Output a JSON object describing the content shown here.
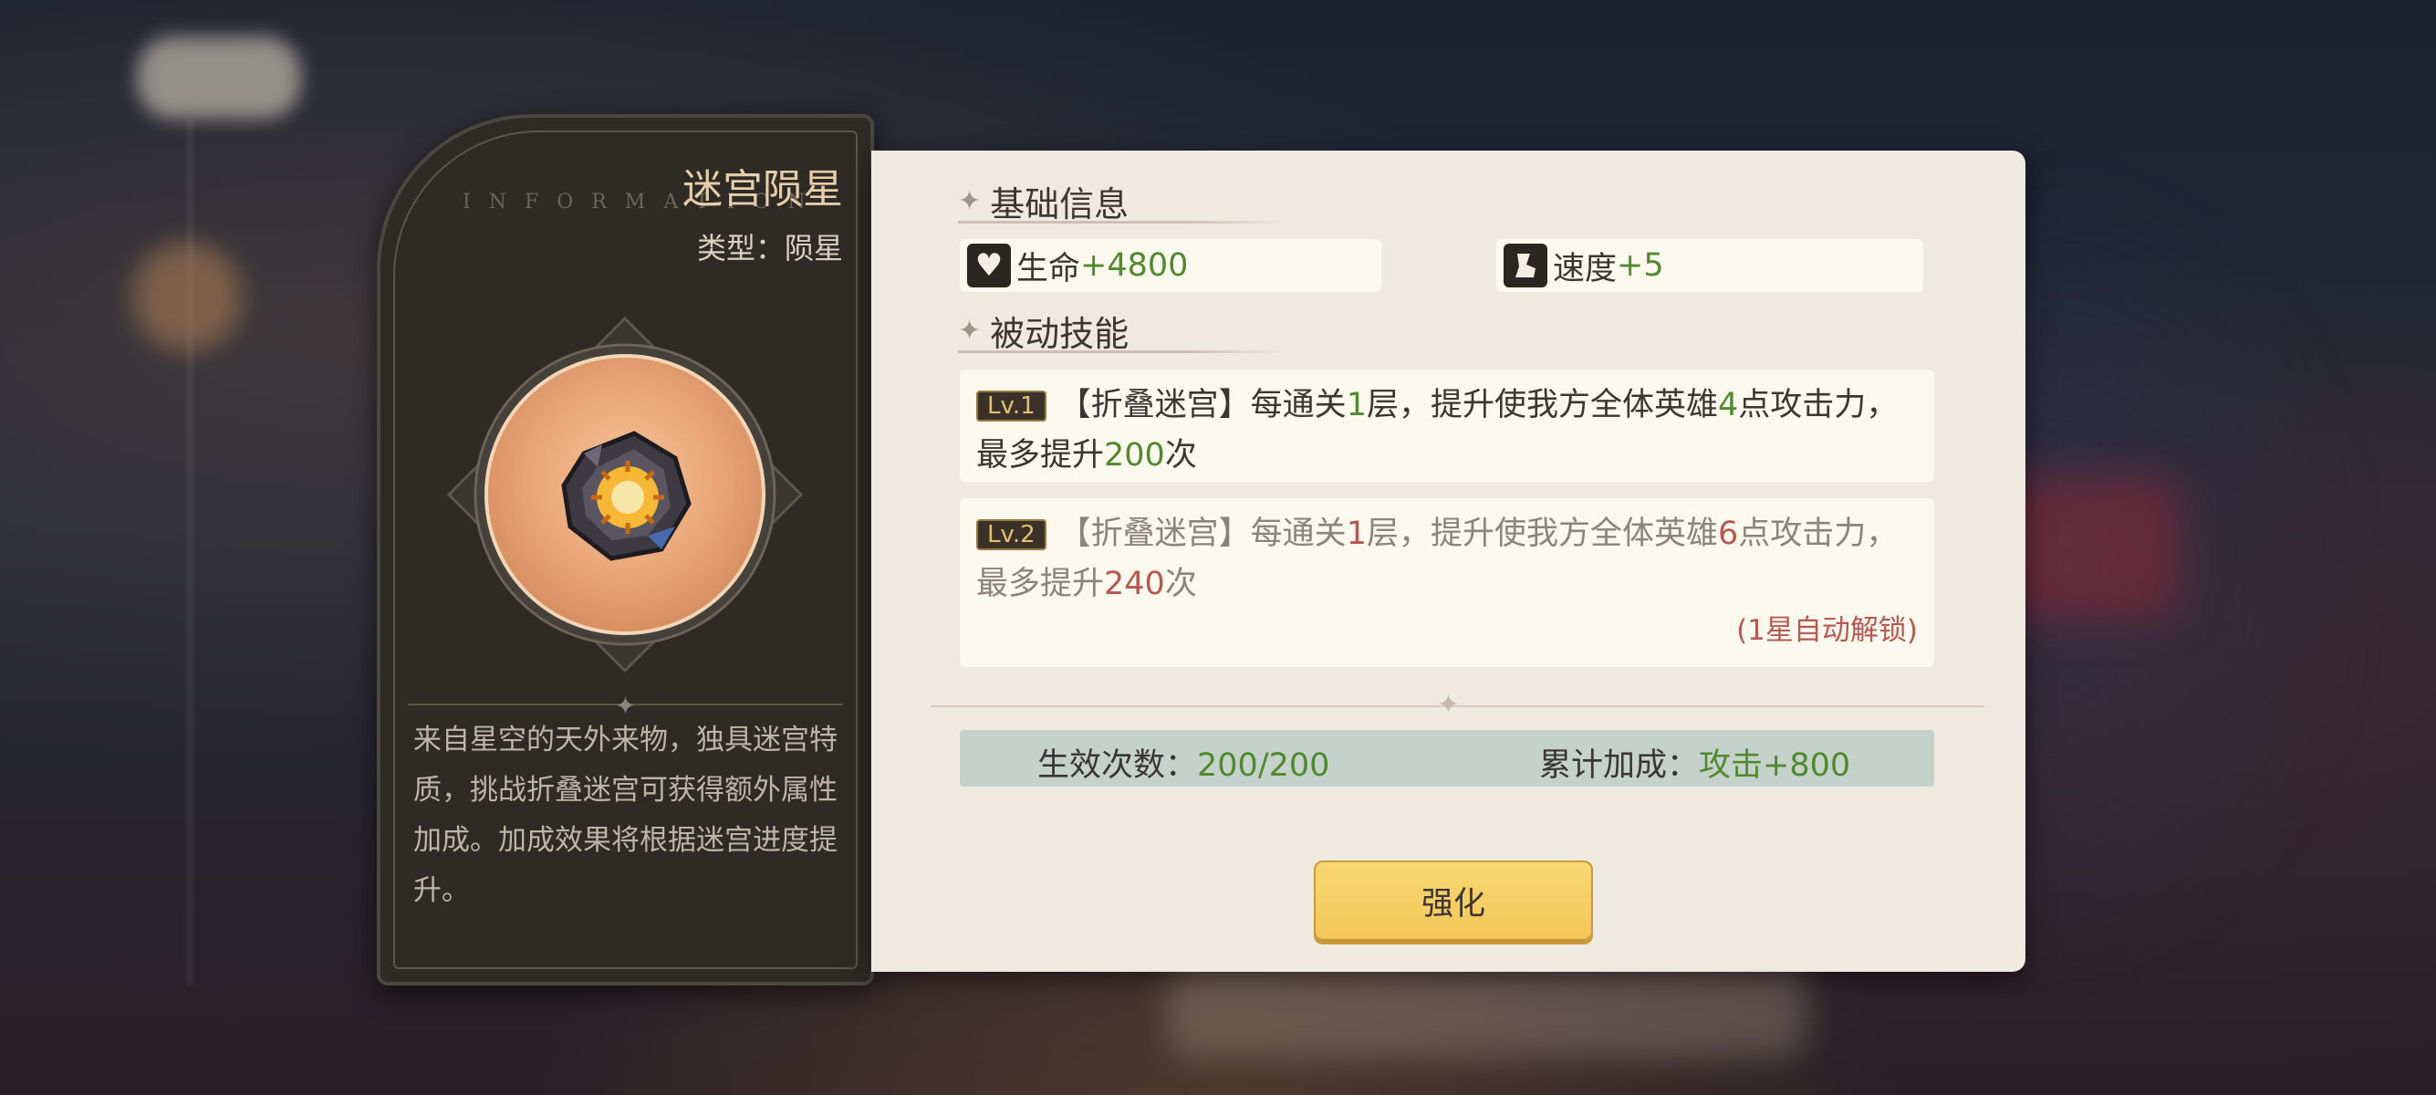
{
  "item": {
    "title": "迷宫陨星",
    "watermark": "INFORMATION",
    "type_label": "类型：",
    "type_value": "陨星",
    "description": "来自星空的天外来物，独具迷宫特质，挑战折叠迷宫可获得额外属性加成。加成效果将根据迷宫进度提升。"
  },
  "basic_info": {
    "heading": "基础信息",
    "stats": [
      {
        "icon": "heart-icon",
        "label": "生命",
        "value": "+4800"
      },
      {
        "icon": "boot-icon",
        "label": "速度",
        "value": "+5"
      }
    ]
  },
  "passive": {
    "heading": "被动技能",
    "skills": [
      {
        "level": "Lv.1",
        "t1": "【折叠迷宫】每通关",
        "n1": "1",
        "t2": "层，提升使我方全体英雄",
        "n2": "4",
        "t3": "点攻击力，最多提升",
        "n3": "200",
        "t4": "次"
      },
      {
        "level": "Lv.2",
        "t1": "【折叠迷宫】每通关",
        "n1": "1",
        "t2": "层，提升使我方全体英雄",
        "n2": "6",
        "t3": "点攻击力，最多提升",
        "n3": "240",
        "t4": "次",
        "unlock": "(1星自动解锁)"
      }
    ]
  },
  "summary": {
    "count_label": "生效次数：",
    "count_value": "200/200",
    "bonus_label": "累计加成：",
    "bonus_value": "攻击+800"
  },
  "actions": {
    "enhance_label": "强化"
  },
  "colors": {
    "positive": "#4f8a2c",
    "locked_value": "#b7574f",
    "button": "#f3c658",
    "panel": "#efeae0"
  }
}
